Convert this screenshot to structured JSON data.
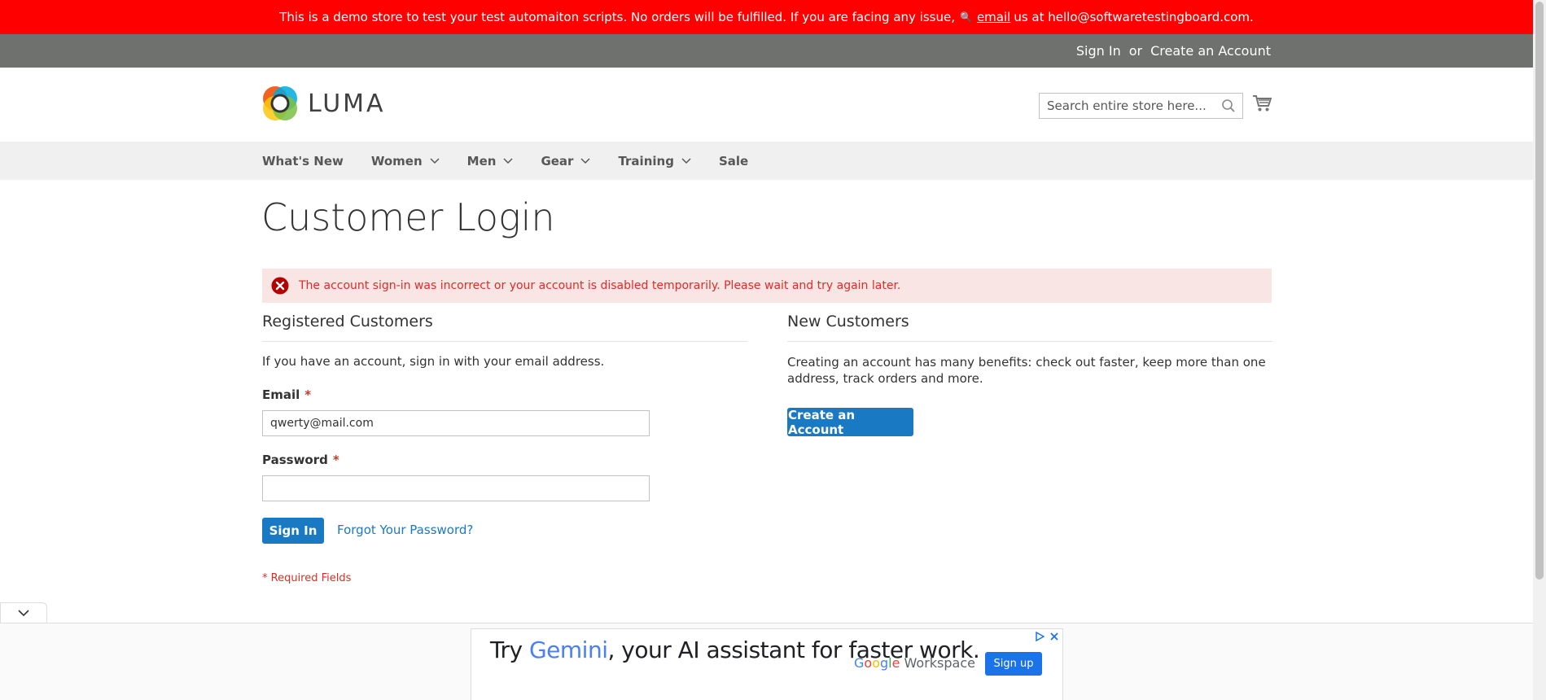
{
  "demo_banner": {
    "text_before": "This is a demo store to test your test automaiton scripts. No orders will be fulfilled. If you are facing any issue,",
    "email_link": "email",
    "text_after": "us at hello@softwaretestingboard.com."
  },
  "top_links": {
    "sign_in": "Sign In",
    "or": "or",
    "create_account": "Create an Account"
  },
  "logo": {
    "text": "LUMA"
  },
  "search": {
    "placeholder": "Search entire store here..."
  },
  "nav": {
    "items": [
      {
        "label": "What's New",
        "has_dropdown": false
      },
      {
        "label": "Women",
        "has_dropdown": true
      },
      {
        "label": "Men",
        "has_dropdown": true
      },
      {
        "label": "Gear",
        "has_dropdown": true
      },
      {
        "label": "Training",
        "has_dropdown": true
      },
      {
        "label": "Sale",
        "has_dropdown": false
      }
    ]
  },
  "page": {
    "title": "Customer Login"
  },
  "error": {
    "message": "The account sign-in was incorrect or your account is disabled temporarily. Please wait and try again later."
  },
  "registered": {
    "heading": "Registered Customers",
    "intro": "If you have an account, sign in with your email address.",
    "email_label": "Email",
    "email_value": "qwerty@mail.com",
    "password_label": "Password",
    "password_value": "",
    "required_mark": "*",
    "sign_in_button": "Sign In",
    "forgot_link": "Forgot Your Password?",
    "required_note": "* Required Fields"
  },
  "new_customers": {
    "heading": "New Customers",
    "intro": "Creating an account has many benefits: check out faster, keep more than one address, track orders and more.",
    "create_button": "Create an Account"
  },
  "ad": {
    "headline_pre": "Try ",
    "headline_brand": "Gemini",
    "headline_post": ", your AI assistant for faster work.",
    "brand_g": "G",
    "brand_o1": "o",
    "brand_o2": "o",
    "brand_g2": "g",
    "brand_l": "l",
    "brand_e": "e",
    "brand_suffix": " Workspace",
    "cta": "Sign up"
  },
  "colors": {
    "banner": "#ff0000",
    "topbar": "#6e716e",
    "primary": "#1979c3",
    "error_bg": "#fae5e5",
    "error_text": "#e02b27"
  }
}
